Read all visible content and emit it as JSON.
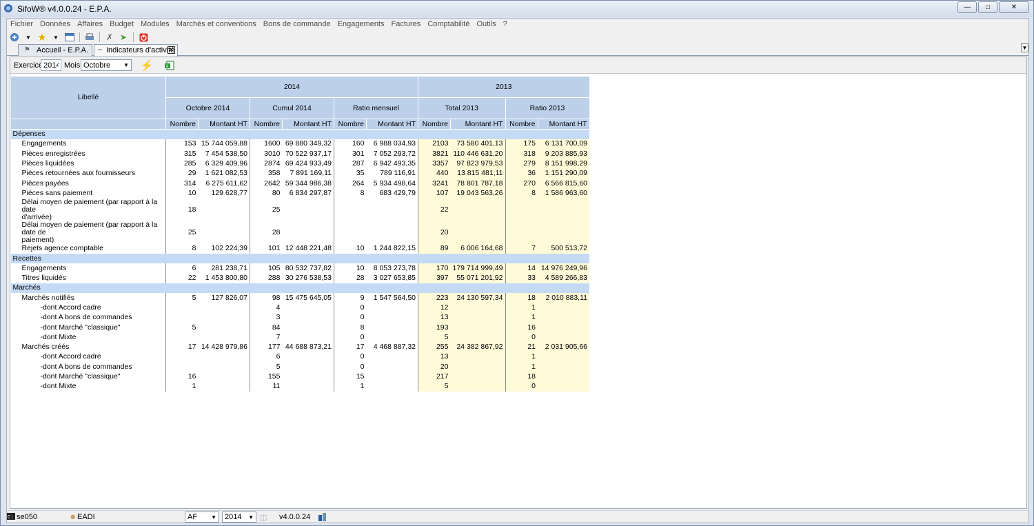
{
  "window": {
    "title": "SifoW® v4.0.0.24 - E.P.A."
  },
  "menu": [
    "Fichier",
    "Données",
    "Affaires",
    "Budget",
    "Modules",
    "Marchés et conventions",
    "Bons de commande",
    "Engagements",
    "Factures",
    "Comptabilité",
    "Outils",
    "?"
  ],
  "tabs": [
    {
      "label": "Accueil - E.P.A."
    },
    {
      "label": "Indicateurs d'activité"
    }
  ],
  "filters": {
    "exercice_label": "Exercice",
    "exercice_value": "2014",
    "mois_label": "Mois",
    "mois_value": "Octobre"
  },
  "grid": {
    "libelle_header": "Libellé",
    "year1": "2014",
    "year2": "2013",
    "groups": [
      "Octobre 2014",
      "Cumul 2014",
      "Ratio mensuel",
      "Total 2013",
      "Ratio 2013"
    ],
    "sub_nombre": "Nombre",
    "sub_montant": "Montant HT",
    "rows": [
      {
        "type": "section",
        "label": "Dépenses"
      },
      {
        "type": "row",
        "indent": 1,
        "label": "Engagements",
        "v": [
          "153",
          "15 744 059,88",
          "1600",
          "69 880 349,32",
          "160",
          "6 988 034,93",
          "2103",
          "73 580 401,13",
          "175",
          "6 131 700,09"
        ]
      },
      {
        "type": "row",
        "indent": 1,
        "label": "Pièces enregistrées",
        "v": [
          "315",
          "7 454 538,50",
          "3010",
          "70 522 937,17",
          "301",
          "7 052 293,72",
          "3821",
          "110 446 631,20",
          "318",
          "9 203 885,93"
        ]
      },
      {
        "type": "row",
        "indent": 1,
        "label": "Pièces liquidées",
        "v": [
          "285",
          "6 329 409,96",
          "2874",
          "69 424 933,49",
          "287",
          "6 942 493,35",
          "3357",
          "97 823 979,53",
          "279",
          "8 151 998,29"
        ]
      },
      {
        "type": "row",
        "indent": 1,
        "label": "Pièces retournées aux fournisseurs",
        "v": [
          "29",
          "1 621 082,53",
          "358",
          "7 891 169,11",
          "35",
          "789 116,91",
          "440",
          "13 815 481,11",
          "36",
          "1 151 290,09"
        ]
      },
      {
        "type": "row",
        "indent": 1,
        "label": "Pièces payées",
        "v": [
          "314",
          "6 275 611,62",
          "2642",
          "59 344 986,38",
          "264",
          "5 934 498,64",
          "3241",
          "78 801 787,18",
          "270",
          "6 566 815,60"
        ]
      },
      {
        "type": "row",
        "indent": 1,
        "label": "Pièces sans paiement",
        "v": [
          "10",
          "129 628,77",
          "80",
          "6 834 297,87",
          "8",
          "683 429,79",
          "107",
          "19 043 563,26",
          "8",
          "1 586 963,60"
        ]
      },
      {
        "type": "row2",
        "indent": 1,
        "label": "Délai moyen de paiement (par rapport à la date",
        "label2": "d'arrivée)",
        "v": [
          "18",
          "",
          "25",
          "",
          "",
          "",
          "22",
          "",
          "",
          ""
        ]
      },
      {
        "type": "row2",
        "indent": 1,
        "label": "Délai moyen de paiement (par rapport à la date de",
        "label2": "paiement)",
        "v": [
          "25",
          "",
          "28",
          "",
          "",
          "",
          "20",
          "",
          "",
          ""
        ]
      },
      {
        "type": "row",
        "indent": 1,
        "label": "Rejets agence comptable",
        "v": [
          "8",
          "102 224,39",
          "101",
          "12 448 221,48",
          "10",
          "1 244 822,15",
          "89",
          "6 006 164,68",
          "7",
          "500 513,72"
        ]
      },
      {
        "type": "section",
        "label": "Recettes"
      },
      {
        "type": "row",
        "indent": 1,
        "label": "Engagements",
        "v": [
          "6",
          "281 238,71",
          "105",
          "80 532 737,82",
          "10",
          "8 053 273,78",
          "170",
          "179 714 999,49",
          "14",
          "14 976 249,96"
        ]
      },
      {
        "type": "row",
        "indent": 1,
        "label": "Titres liquidés",
        "v": [
          "22",
          "1 453 800,80",
          "288",
          "30 276 538,53",
          "28",
          "3 027 653,85",
          "397",
          "55 071 201,92",
          "33",
          "4 589 266,83"
        ]
      },
      {
        "type": "section",
        "label": "Marchés"
      },
      {
        "type": "row",
        "indent": 1,
        "label": "Marchés notifiés",
        "v": [
          "5",
          "127 826,07",
          "98",
          "15 475 645,05",
          "9",
          "1 547 564,50",
          "223",
          "24 130 597,34",
          "18",
          "2 010 883,11"
        ]
      },
      {
        "type": "row",
        "indent": 2,
        "label": "-dont Accord cadre",
        "v": [
          "",
          "",
          "4",
          "",
          "0",
          "",
          "12",
          "",
          "1",
          ""
        ]
      },
      {
        "type": "row",
        "indent": 2,
        "label": "-dont A bons de commandes",
        "v": [
          "",
          "",
          "3",
          "",
          "0",
          "",
          "13",
          "",
          "1",
          ""
        ]
      },
      {
        "type": "row",
        "indent": 2,
        "label": "-dont Marché \"classique\"",
        "v": [
          "5",
          "",
          "84",
          "",
          "8",
          "",
          "193",
          "",
          "16",
          ""
        ]
      },
      {
        "type": "row",
        "indent": 2,
        "label": "-dont Mixte",
        "v": [
          "",
          "",
          "7",
          "",
          "0",
          "",
          "5",
          "",
          "0",
          ""
        ]
      },
      {
        "type": "row",
        "indent": 1,
        "label": "Marchés créés",
        "v": [
          "17",
          "14 428 979,86",
          "177",
          "44 688 873,21",
          "17",
          "4 468 887,32",
          "255",
          "24 382 867,92",
          "21",
          "2 031 905,66"
        ]
      },
      {
        "type": "row",
        "indent": 2,
        "label": "-dont Accord cadre",
        "v": [
          "",
          "",
          "6",
          "",
          "0",
          "",
          "13",
          "",
          "1",
          ""
        ]
      },
      {
        "type": "row",
        "indent": 2,
        "label": "-dont A bons de commandes",
        "v": [
          "",
          "",
          "5",
          "",
          "0",
          "",
          "20",
          "",
          "1",
          ""
        ]
      },
      {
        "type": "row",
        "indent": 2,
        "label": "-dont Marché \"classique\"",
        "v": [
          "16",
          "",
          "155",
          "",
          "15",
          "",
          "217",
          "",
          "18",
          ""
        ]
      },
      {
        "type": "row",
        "indent": 2,
        "label": "-dont Mixte",
        "v": [
          "1",
          "",
          "11",
          "",
          "1",
          "",
          "5",
          "",
          "0",
          ""
        ]
      }
    ]
  },
  "status": {
    "user": "se050",
    "org": "EADI",
    "af": "AF",
    "year": "2014",
    "version": "v4.0.0.24"
  },
  "colors": {
    "header": "#bcd0ea",
    "section": "#c5dbf5",
    "highlight_2013": "#fffbd9"
  }
}
